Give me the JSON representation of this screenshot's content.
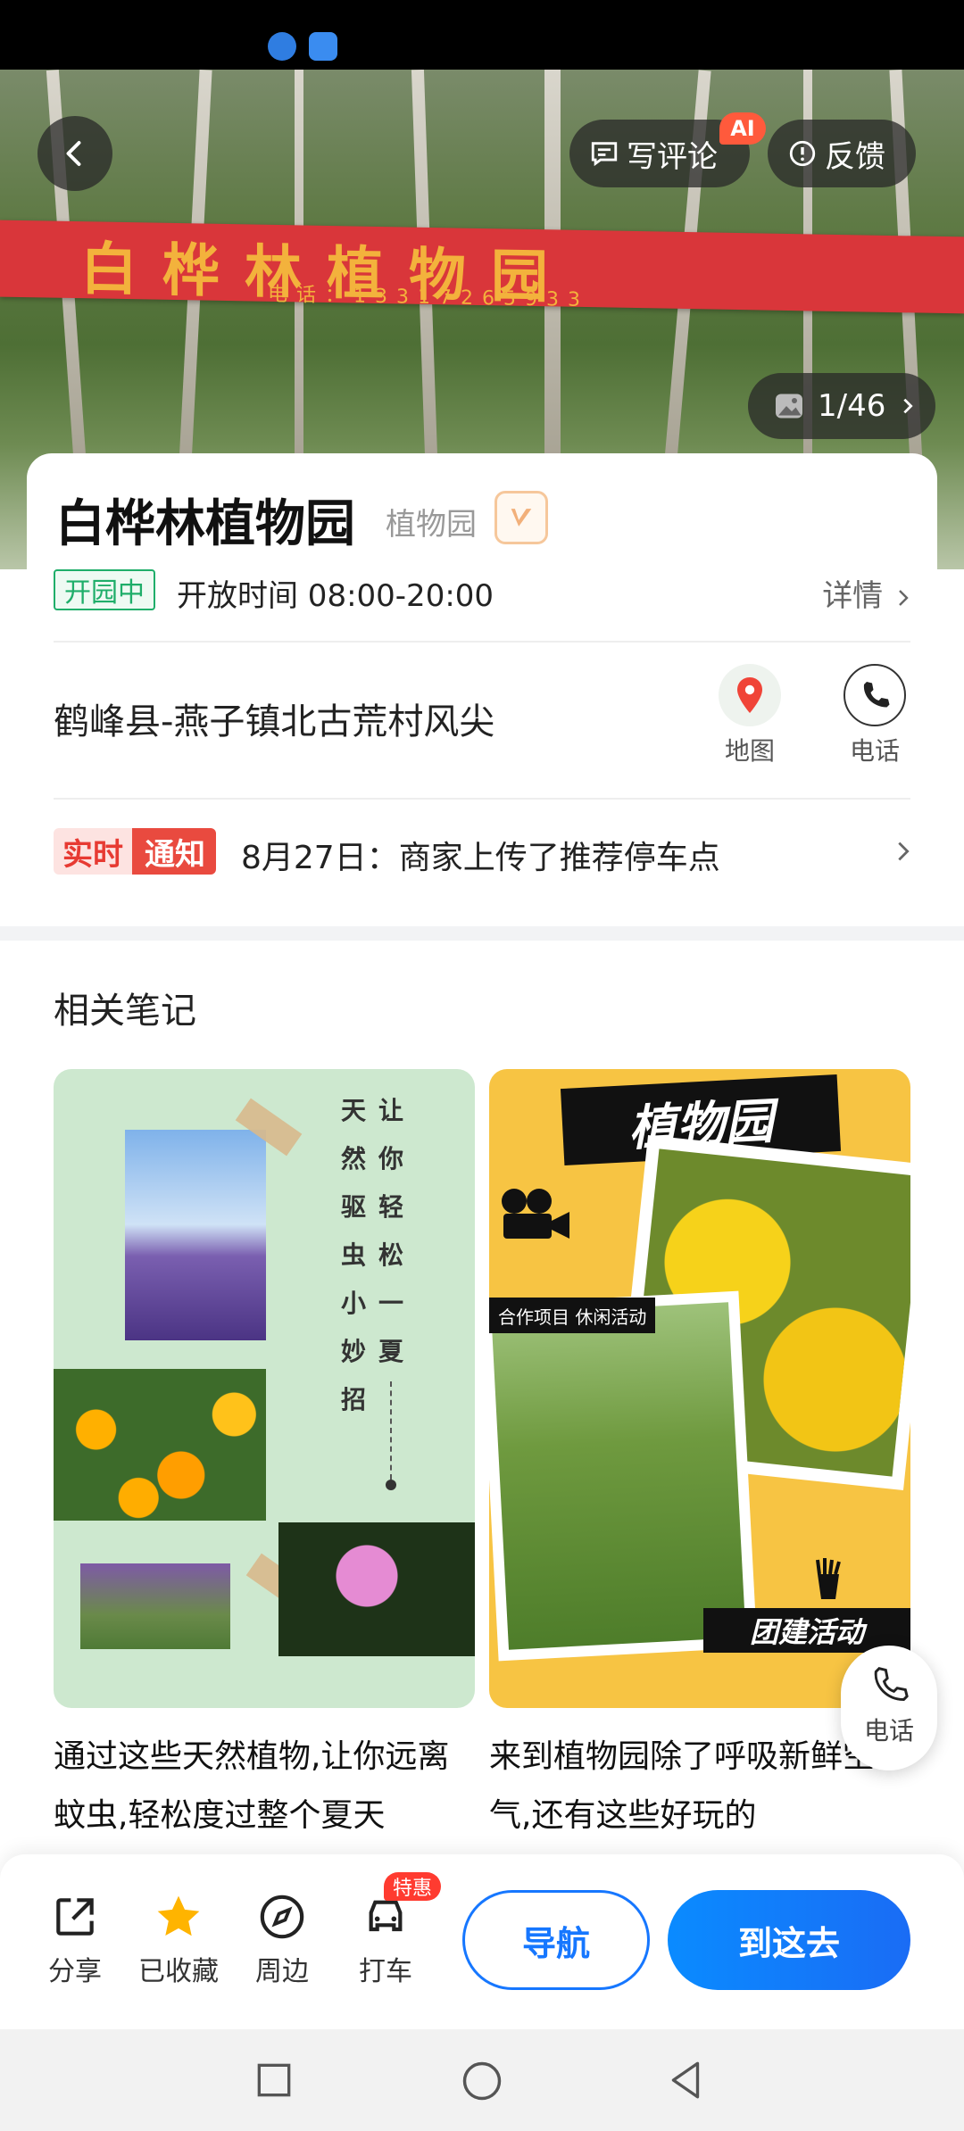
{
  "hero": {
    "banner_title": "白桦林植物园",
    "banner_phone": "电话：13317265933",
    "write_review_label": "写评论",
    "ai_badge": "AI",
    "feedback_label": "反馈",
    "photo_count": "1/46"
  },
  "place": {
    "name": "白桦林植物园",
    "category": "植物园",
    "status": "开园中",
    "hours": "开放时间 08:00-20:00",
    "detail_label": "详情",
    "address": "鹤峰县-燕子镇北古荒村风尖",
    "map_label": "地图",
    "phone_label": "电话",
    "notice_tag_a": "实时",
    "notice_tag_b": "通知",
    "notice_text": "8月27日：商家上传了推荐停车点"
  },
  "notes": {
    "section_title": "相关笔记",
    "note1": {
      "col1": [
        "天",
        "然",
        "驱",
        "虫",
        "小",
        "妙",
        "招"
      ],
      "col2": [
        "让",
        "你",
        "轻",
        "松",
        "一",
        "夏"
      ],
      "text": "通过这些天然植物,让你远离蚊虫,轻松度过整个夏天"
    },
    "note2": {
      "headline": "植物园",
      "tag": "合作项目 休闲活动",
      "ribbon": "团建活动",
      "text": "来到植物园除了呼吸新鲜空气,还有这些好玩的"
    }
  },
  "float_call_label": "电话",
  "bottom_bar": {
    "share": "分享",
    "favorited": "已收藏",
    "nearby": "周边",
    "taxi": "打车",
    "promo": "特惠",
    "navigate": "导航",
    "go_here": "到这去"
  },
  "colors": {
    "primary": "#1677ff",
    "open_green": "#1fae6a",
    "notice_red": "#e94a3f"
  }
}
